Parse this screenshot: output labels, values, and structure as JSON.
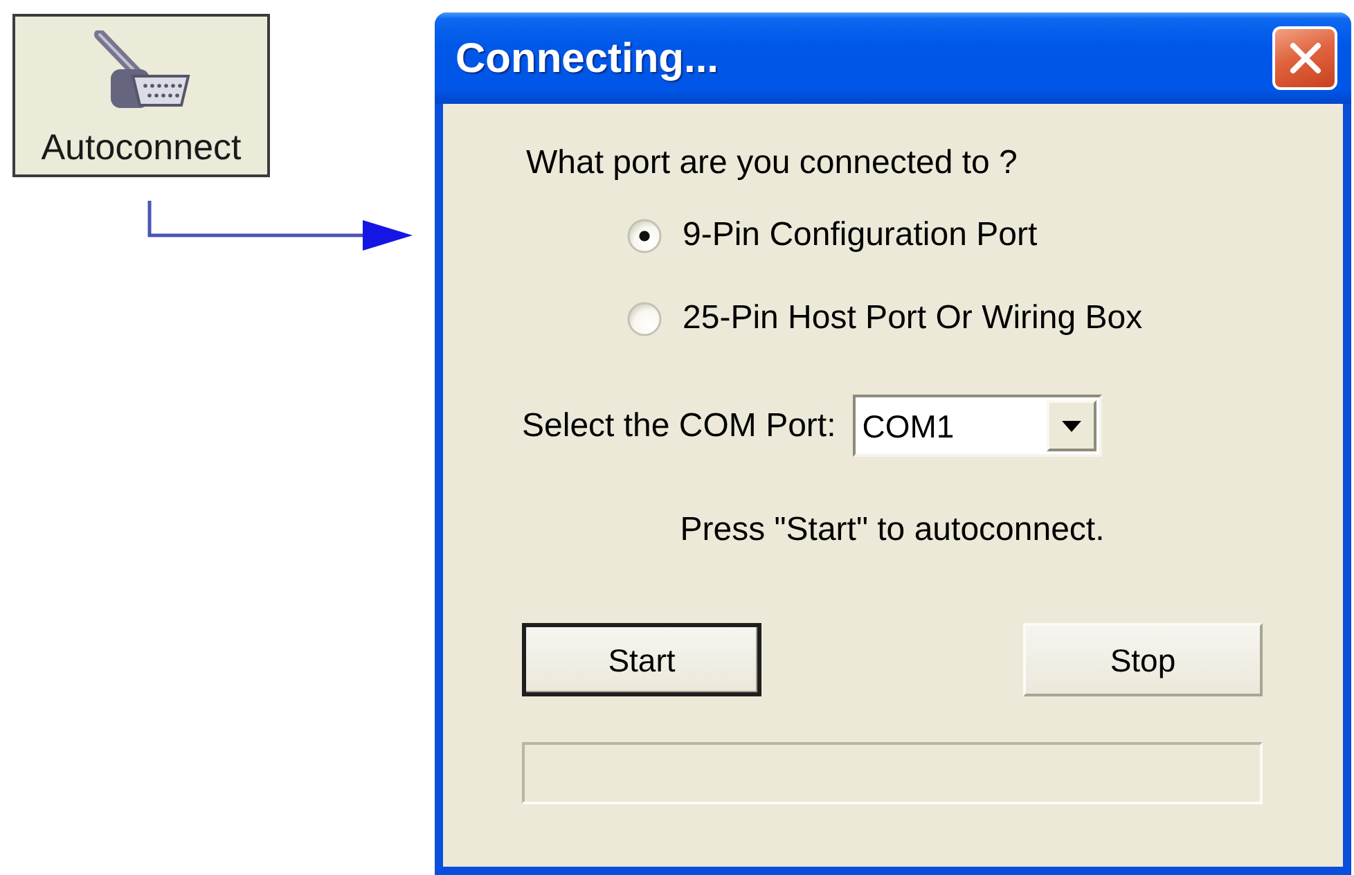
{
  "launcher": {
    "label": "Autoconnect"
  },
  "dialog": {
    "title": "Connecting...",
    "question": "What port are you connected to ?",
    "ports": [
      {
        "label": "9-Pin Configuration Port",
        "selected": true
      },
      {
        "label": "25-Pin Host Port Or Wiring Box",
        "selected": false
      }
    ],
    "com_port": {
      "label": "Select the COM Port:",
      "value": "COM1"
    },
    "hint": "Press \"Start\" to autoconnect.",
    "buttons": [
      {
        "label": "Start",
        "default": true
      },
      {
        "label": "Stop",
        "default": false
      }
    ],
    "progress": {
      "level": 0
    }
  }
}
